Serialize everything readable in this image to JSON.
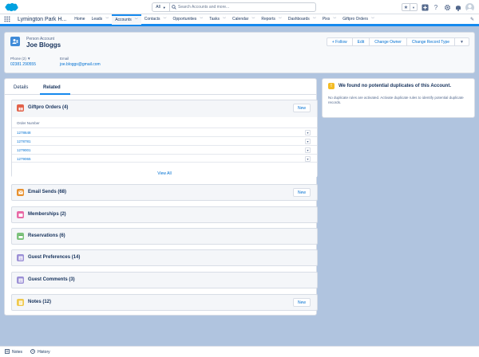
{
  "header": {
    "search_scope": "All",
    "search_placeholder": "Search Accounts and more...",
    "icon_names": [
      "star-icon",
      "add-icon",
      "help-icon",
      "setup-gear-icon",
      "notification-bell-icon",
      "user-avatar"
    ]
  },
  "nav": {
    "app_name": "Lymington Park H...",
    "items": [
      {
        "label": "Home",
        "has_menu": false
      },
      {
        "label": "Leads",
        "has_menu": true
      },
      {
        "label": "Accounts",
        "has_menu": true,
        "active": true
      },
      {
        "label": "Contacts",
        "has_menu": true
      },
      {
        "label": "Opportunities",
        "has_menu": true
      },
      {
        "label": "Tasks",
        "has_menu": true
      },
      {
        "label": "Calendar",
        "has_menu": true
      },
      {
        "label": "Reports",
        "has_menu": true
      },
      {
        "label": "Dashboards",
        "has_menu": true
      },
      {
        "label": "Pixs",
        "has_menu": true
      },
      {
        "label": "Giftpro Orders",
        "has_menu": true
      }
    ]
  },
  "record": {
    "type_label": "Person Account",
    "name": "Joe Bloggs",
    "actions": [
      "+ Follow",
      "Edit",
      "Change Owner",
      "Change Record Type"
    ],
    "phone_label": "Phone (2)",
    "phone_value": "02381 290555",
    "email_label": "Email",
    "email_value": "joe.bloggs@gmail.com"
  },
  "tabs": {
    "details": "Details",
    "related": "Related"
  },
  "related": {
    "giftpro": {
      "title": "Giftpro Orders (4)",
      "new_label": "New",
      "column": "Order Number",
      "orders": [
        "1278648",
        "1278781",
        "1279001",
        "1279065"
      ],
      "view_all": "View All"
    },
    "lists": [
      {
        "title": "Email Sends (68)",
        "has_new": true,
        "new_label": "New",
        "icon": "email-icon",
        "color": "#e8912f"
      },
      {
        "title": "Memberships (2)",
        "has_new": false,
        "icon": "membership-icon",
        "color": "#e86aa6"
      },
      {
        "title": "Reservations (6)",
        "has_new": false,
        "icon": "reservation-icon",
        "color": "#7dc37d"
      },
      {
        "title": "Guest Preferences (14)",
        "has_new": false,
        "icon": "preferences-icon",
        "color": "#9b8fd6"
      },
      {
        "title": "Guest Comments (3)",
        "has_new": false,
        "icon": "comments-icon",
        "color": "#9b8fd6"
      },
      {
        "title": "Notes (12)",
        "has_new": true,
        "new_label": "New",
        "icon": "notes-icon",
        "color": "#f0c94d"
      }
    ]
  },
  "duplicates": {
    "title": "We found no potential duplicates of this Account.",
    "text": "No duplicate rules are activated. Activate duplicate rules to identify potential duplicate records."
  },
  "utility": {
    "notes": "Notes",
    "history": "History"
  },
  "colors": {
    "brand_blue": "#1589ee",
    "link_blue": "#0070d2",
    "background": "#b0c4df"
  }
}
